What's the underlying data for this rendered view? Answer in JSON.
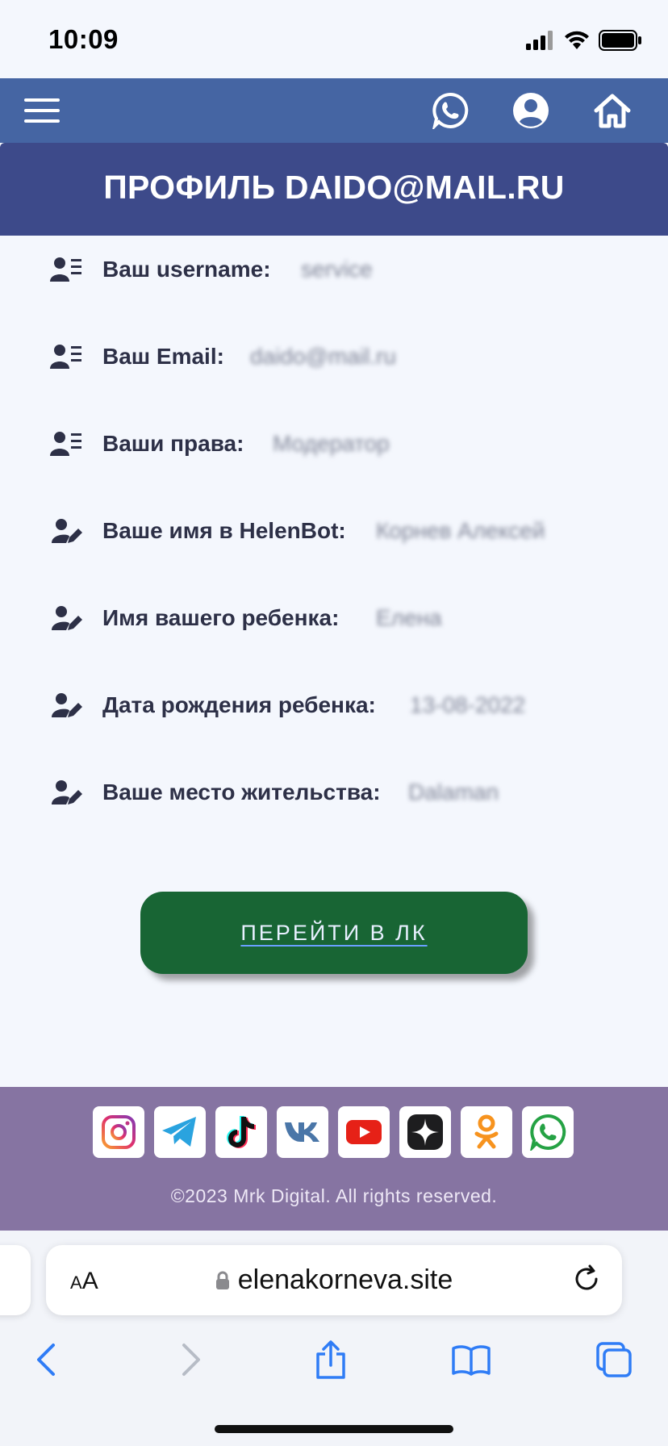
{
  "status_bar": {
    "time": "10:09"
  },
  "nav": {
    "menu_icon": "hamburger-icon",
    "icons": [
      "whatsapp-icon",
      "user-icon",
      "home-icon"
    ]
  },
  "profile": {
    "title": "ПРОФИЛЬ DAIDO@MAIL.RU",
    "fields": [
      {
        "label": "Ваш username:",
        "value": "service",
        "icon": "user-list-icon"
      },
      {
        "label": "Ваш Email:",
        "value": "daido@mail.ru",
        "icon": "user-list-icon"
      },
      {
        "label": "Ваши права:",
        "value": "Модератор",
        "icon": "user-list-icon"
      },
      {
        "label": "Ваше имя в HelenBot:",
        "value": "Корнев Алексей",
        "icon": "user-edit-icon"
      },
      {
        "label": "Имя вашего ребенка:",
        "value": "Елена",
        "icon": "user-edit-icon"
      },
      {
        "label": "Дата рождения ребенка:",
        "value": "13-08-2022",
        "icon": "user-edit-icon"
      },
      {
        "label": "Ваше место жительства:",
        "value": "Dalaman",
        "icon": "user-edit-icon"
      }
    ],
    "button_label": "ПЕРЕЙТИ В ЛК"
  },
  "footer": {
    "social": [
      "instagram-icon",
      "telegram-icon",
      "tiktok-icon",
      "vk-icon",
      "youtube-icon",
      "zen-icon",
      "odnoklassniki-icon",
      "whatsapp-icon"
    ],
    "copyright": "©2023 Mrk Digital. All rights reserved."
  },
  "browser": {
    "aa_small": "A",
    "aa_big": "A",
    "url": "elenakorneva.site"
  },
  "colors": {
    "nav": "#4565a3",
    "title_band": "#3d4a8a",
    "button": "#186534",
    "footer": "#8674a2"
  }
}
